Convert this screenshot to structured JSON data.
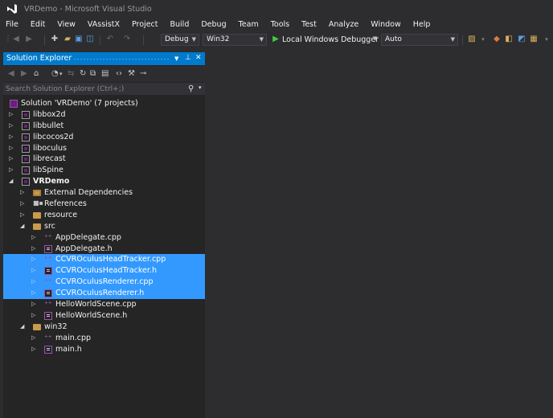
{
  "window": {
    "title": "VRDemo - Microsoft Visual Studio"
  },
  "menu": [
    "File",
    "Edit",
    "View",
    "VAssistX",
    "Project",
    "Build",
    "Debug",
    "Team",
    "Tools",
    "Test",
    "Analyze",
    "Window",
    "Help"
  ],
  "toolbar": {
    "configuration": "Debug",
    "platform": "Win32",
    "run_label": "Local Windows Debugger",
    "run_dropdown": "Auto"
  },
  "solution_explorer": {
    "title": "Solution Explorer",
    "search_placeholder": "Search Solution Explorer (Ctrl+;)",
    "tree": [
      {
        "label": "Solution 'VRDemo' (7 projects)",
        "icon": "solution-icon",
        "depth": 0,
        "expander": "",
        "selected": false
      },
      {
        "label": "libbox2d",
        "icon": "project-icon",
        "depth": 0,
        "expander": "collapsed",
        "selected": false
      },
      {
        "label": "libbullet",
        "icon": "project-icon",
        "depth": 0,
        "expander": "collapsed",
        "selected": false
      },
      {
        "label": "libcocos2d",
        "icon": "project-icon",
        "depth": 0,
        "expander": "collapsed",
        "selected": false
      },
      {
        "label": "liboculus",
        "icon": "project-icon",
        "depth": 0,
        "expander": "collapsed",
        "selected": false
      },
      {
        "label": "librecast",
        "icon": "project-icon",
        "depth": 0,
        "expander": "collapsed",
        "selected": false
      },
      {
        "label": "libSpine",
        "icon": "project-icon",
        "depth": 0,
        "expander": "collapsed",
        "selected": false
      },
      {
        "label": "VRDemo",
        "icon": "project-icon",
        "depth": 0,
        "expander": "expanded",
        "selected": false,
        "bold": true
      },
      {
        "label": "External Dependencies",
        "icon": "external-deps-icon",
        "depth": 1,
        "expander": "collapsed",
        "selected": false
      },
      {
        "label": "References",
        "icon": "references-icon",
        "depth": 1,
        "expander": "collapsed",
        "selected": false
      },
      {
        "label": "resource",
        "icon": "folder-icon",
        "depth": 1,
        "expander": "collapsed",
        "selected": false
      },
      {
        "label": "src",
        "icon": "folder-icon",
        "depth": 1,
        "expander": "expanded",
        "selected": false
      },
      {
        "label": "AppDelegate.cpp",
        "icon": "cpp-file-icon",
        "depth": 2,
        "expander": "collapsed",
        "selected": false
      },
      {
        "label": "AppDelegate.h",
        "icon": "header-file-icon",
        "depth": 2,
        "expander": "collapsed",
        "selected": false
      },
      {
        "label": "CCVROculusHeadTracker.cpp",
        "icon": "cpp-file-icon",
        "depth": 2,
        "expander": "collapsed",
        "selected": true
      },
      {
        "label": "CCVROculusHeadTracker.h",
        "icon": "header-file-icon",
        "depth": 2,
        "expander": "collapsed",
        "selected": true
      },
      {
        "label": "CCVROculusRenderer.cpp",
        "icon": "cpp-file-icon",
        "depth": 2,
        "expander": "collapsed",
        "selected": true
      },
      {
        "label": "CCVROculusRenderer.h",
        "icon": "header-file-icon",
        "depth": 2,
        "expander": "collapsed",
        "selected": true
      },
      {
        "label": "HelloWorldScene.cpp",
        "icon": "cpp-file-icon",
        "depth": 2,
        "expander": "collapsed",
        "selected": false
      },
      {
        "label": "HelloWorldScene.h",
        "icon": "header-file-icon",
        "depth": 2,
        "expander": "collapsed",
        "selected": false
      },
      {
        "label": "win32",
        "icon": "folder-icon",
        "depth": 1,
        "expander": "expanded",
        "selected": false
      },
      {
        "label": "main.cpp",
        "icon": "cpp-file-icon",
        "depth": 2,
        "expander": "collapsed",
        "selected": false
      },
      {
        "label": "main.h",
        "icon": "header-file-icon",
        "depth": 2,
        "expander": "collapsed",
        "selected": false
      }
    ]
  },
  "colors": {
    "accent": "#007acc",
    "selection": "#3399ff",
    "background": "#2d2d30",
    "panel": "#252526"
  }
}
